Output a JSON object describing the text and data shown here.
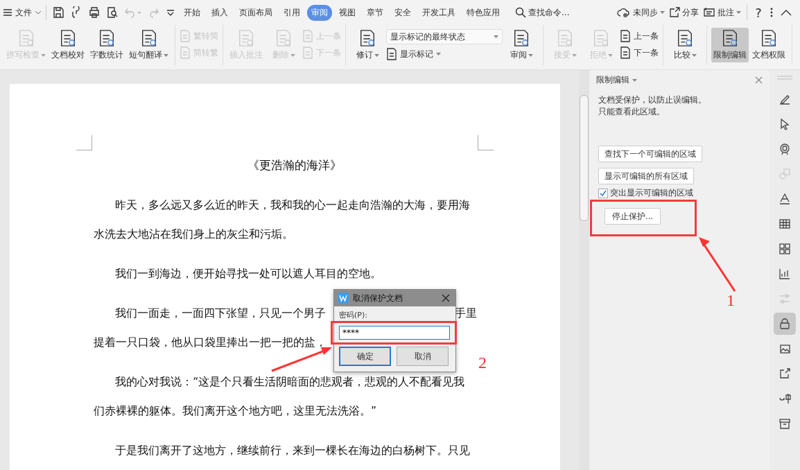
{
  "menu": {
    "label": "文件"
  },
  "tabs": [
    {
      "label": "开始",
      "selected": false
    },
    {
      "label": "插入",
      "selected": false
    },
    {
      "label": "页面布局",
      "selected": false
    },
    {
      "label": "引用",
      "selected": false
    },
    {
      "label": "审阅",
      "selected": true
    },
    {
      "label": "视图",
      "selected": false
    },
    {
      "label": "章节",
      "selected": false
    },
    {
      "label": "安全",
      "selected": false
    },
    {
      "label": "开发工具",
      "selected": false
    },
    {
      "label": "特色应用",
      "selected": false
    }
  ],
  "search": {
    "placeholder": "查找命令..."
  },
  "top_actions": [
    {
      "kind": "sync",
      "label": "未同步",
      "dropdown": true
    },
    {
      "kind": "share",
      "label": "分享",
      "dropdown": false
    },
    {
      "kind": "comment",
      "label": "批注",
      "dropdown": true
    }
  ],
  "help": "?",
  "ribbon": [
    {
      "items": [
        {
          "kind": "large",
          "label": "拼写检查",
          "disabled": true,
          "dropdown": true,
          "selected": false
        },
        {
          "kind": "large",
          "label": "文档校对",
          "disabled": false,
          "dropdown": false,
          "selected": false
        },
        {
          "kind": "large",
          "label": "字数统计",
          "disabled": false,
          "dropdown": false,
          "selected": false
        },
        {
          "kind": "large",
          "label": "短句翻译",
          "disabled": false,
          "dropdown": true,
          "selected": false
        }
      ]
    },
    {
      "items": [
        {
          "kind": "stack",
          "rows": [
            {
              "kind": "small",
              "label": "繁转简",
              "disabled": true,
              "dropdown": false
            },
            {
              "kind": "small",
              "label": "简转繁",
              "disabled": true,
              "dropdown": false
            }
          ]
        }
      ]
    },
    {
      "items": [
        {
          "kind": "large",
          "label": "插入批注",
          "disabled": true,
          "dropdown": false,
          "selected": false
        },
        {
          "kind": "large",
          "label": "删除",
          "disabled": true,
          "dropdown": true,
          "selected": false
        },
        {
          "kind": "stack",
          "rows": [
            {
              "kind": "small",
              "label": "上一条",
              "disabled": true,
              "dropdown": false
            },
            {
              "kind": "small",
              "label": "下一条",
              "disabled": true,
              "dropdown": false
            }
          ]
        }
      ]
    },
    {
      "items": [
        {
          "kind": "large",
          "label": "修订",
          "disabled": false,
          "dropdown": true,
          "selected": false
        },
        {
          "kind": "stack",
          "rows": [
            {
              "kind": "select",
              "label": "显示标记的最终状态"
            },
            {
              "kind": "small",
              "label": "显示标记",
              "disabled": false,
              "dropdown": true
            }
          ]
        },
        {
          "kind": "large",
          "label": "审阅",
          "disabled": false,
          "dropdown": true,
          "selected": false
        }
      ]
    },
    {
      "items": [
        {
          "kind": "large",
          "label": "接受",
          "disabled": true,
          "dropdown": true,
          "selected": false
        },
        {
          "kind": "large",
          "label": "拒绝",
          "disabled": true,
          "dropdown": true,
          "selected": false
        },
        {
          "kind": "stack",
          "rows": [
            {
              "kind": "small",
              "label": "上一条",
              "disabled": false,
              "dropdown": false
            },
            {
              "kind": "small",
              "label": "下一条",
              "disabled": false,
              "dropdown": false
            }
          ]
        }
      ]
    },
    {
      "items": [
        {
          "kind": "large",
          "label": "比较",
          "disabled": false,
          "dropdown": true,
          "selected": false
        }
      ]
    },
    {
      "items": [
        {
          "kind": "large",
          "label": "限制编辑",
          "disabled": false,
          "dropdown": false,
          "selected": true
        },
        {
          "kind": "large",
          "label": "文档权限",
          "disabled": false,
          "dropdown": false,
          "selected": false
        }
      ]
    }
  ],
  "document": {
    "title": "《更浩瀚的海洋》",
    "paragraphs": [
      {
        "lines": [
          [
            "昨天，多么远又多么近的昨天，我和我的心一起走向浩瀚的大海，要用海"
          ],
          [
            "水洗去大地沾在我们身上的灰尘和污垢。"
          ]
        ]
      },
      {
        "lines": [
          [
            "我们一到海边，便开始寻找一处可以遮人耳目的空地。"
          ]
        ]
      },
      {
        "lines": [
          [
            "我们一面走，一面四下张望，只见一个男子",
            "手里"
          ],
          [
            "提着一只口袋，他从口袋里捧出一把一把的盐，"
          ]
        ]
      },
      {
        "lines": [
          [
            "我的心对我说：“这是个只看生活阴暗面的悲观者，悲观的人不配看见我"
          ],
          [
            "们赤裸裸的躯体。我们离开这个地方吧，这里无法洗浴。”"
          ]
        ]
      },
      {
        "lines": [
          [
            "于是我们离开了这地方，继续前行，来到一棵长在海边的白杨树下。只见"
          ]
        ]
      }
    ]
  },
  "panel": {
    "title": "限制编辑",
    "description": [
      "文档受保护，以防止误编辑。",
      "只能查看此区域。"
    ],
    "buttons": [
      "查找下一个可编辑的区域",
      "显示可编辑的所有区域"
    ],
    "checkbox": {
      "label": "突出显示可编辑的区域",
      "checked": true
    },
    "stop_button": "停止保护..."
  },
  "side_tools": [
    {
      "kind": "pen",
      "selected": false,
      "disabled": false
    },
    {
      "kind": "cursor",
      "selected": false,
      "disabled": false
    },
    {
      "kind": "badge",
      "selected": false,
      "disabled": false
    },
    {
      "kind": "shapes",
      "selected": false,
      "disabled": true
    },
    {
      "kind": "textstyle",
      "selected": false,
      "disabled": false
    },
    {
      "kind": "table",
      "selected": false,
      "disabled": false
    },
    {
      "kind": "grid",
      "selected": false,
      "disabled": false
    },
    {
      "kind": "chart",
      "selected": false,
      "disabled": false
    },
    {
      "kind": "sliders",
      "selected": false,
      "disabled": true
    },
    {
      "kind": "lock",
      "selected": true,
      "disabled": false
    },
    {
      "kind": "image",
      "selected": false,
      "disabled": false
    },
    {
      "kind": "share",
      "selected": false,
      "disabled": false
    },
    {
      "kind": "translate",
      "selected": false,
      "disabled": false
    },
    {
      "kind": "archive",
      "selected": false,
      "disabled": false
    }
  ],
  "dialog": {
    "title": "取消保护文档",
    "field_label": "密码(P):",
    "password": "****",
    "buttons": [
      {
        "label": "确定",
        "default": true
      },
      {
        "label": "取消",
        "default": false
      }
    ]
  },
  "annotations": [
    {
      "kind": "frame"
    },
    {
      "kind": "frame"
    },
    {
      "kind": "arrow"
    },
    {
      "kind": "arrow"
    },
    {
      "kind": "number",
      "label": "1"
    },
    {
      "kind": "number",
      "label": "2"
    }
  ]
}
